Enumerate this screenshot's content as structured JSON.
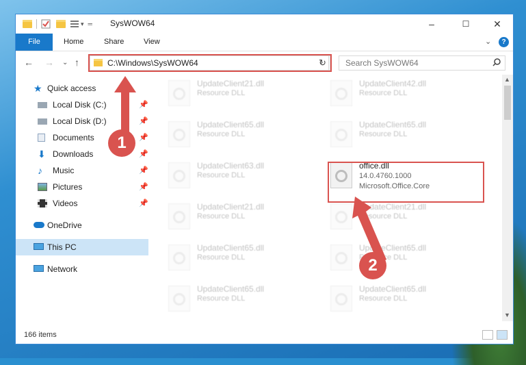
{
  "window": {
    "title": "SysWOW64",
    "minimize": "–",
    "maximize": "☐",
    "close": "✕"
  },
  "ribbon": {
    "tabs": [
      "File",
      "Home",
      "Share",
      "View"
    ],
    "expand": "⌄",
    "help": "?"
  },
  "navigation": {
    "back": "←",
    "forward": "→",
    "recent": "⌄",
    "up": "↑",
    "address": "C:\\Windows\\SysWOW64",
    "address_dropdown": "⌄",
    "refresh": "↻",
    "search_placeholder": "Search SysWOW64"
  },
  "sidebar": {
    "items": [
      {
        "label": "Quick access",
        "icon": "star-icon"
      },
      {
        "label": "Local Disk (C:)",
        "icon": "drive-icon",
        "pinned": true
      },
      {
        "label": "Local Disk (D:)",
        "icon": "drive-icon",
        "pinned": true
      },
      {
        "label": "Documents",
        "icon": "documents-icon",
        "pinned": true
      },
      {
        "label": "Downloads",
        "icon": "download-icon",
        "pinned": true
      },
      {
        "label": "Music",
        "icon": "music-icon",
        "pinned": true
      },
      {
        "label": "Pictures",
        "icon": "pictures-icon",
        "pinned": true
      },
      {
        "label": "Videos",
        "icon": "videos-icon",
        "pinned": true
      },
      {
        "label": "OneDrive",
        "icon": "cloud-icon"
      },
      {
        "label": "This PC",
        "icon": "computer-icon",
        "selected": true
      },
      {
        "label": "Network",
        "icon": "network-icon"
      }
    ]
  },
  "files": {
    "left_column": [
      {
        "name": "UpdateClient21.dll",
        "type": "Resource DLL"
      },
      {
        "name": "UpdateClient65.dll",
        "type": "Resource DLL"
      },
      {
        "name": "UpdateClient63.dll",
        "type": "Resource DLL"
      },
      {
        "name": "UpdateClient21.dll",
        "type": "Resource DLL"
      },
      {
        "name": "UpdateClient65.dll",
        "type": "Resource DLL"
      },
      {
        "name": "UpdateClient65.dll",
        "type": "Resource DLL"
      }
    ],
    "right_column": [
      {
        "name": "UpdateClient42.dll",
        "type": "Resource DLL"
      },
      {
        "name": "UpdateClient65.dll",
        "type": "Resource DLL"
      },
      {
        "name": "office.dll",
        "version": "14.0.4760.1000",
        "product": "Microsoft.Office.Core"
      },
      {
        "name": "UpdateClient21.dll",
        "type": "Resource DLL"
      },
      {
        "name": "UpdateClient65.dll",
        "type": "Resource DLL"
      },
      {
        "name": "UpdateClient65.dll",
        "type": "Resource DLL"
      }
    ]
  },
  "status": {
    "item_count": "166 items"
  },
  "annotations": {
    "step1": "1",
    "step2": "2",
    "highlight_color": "#d9534f"
  }
}
